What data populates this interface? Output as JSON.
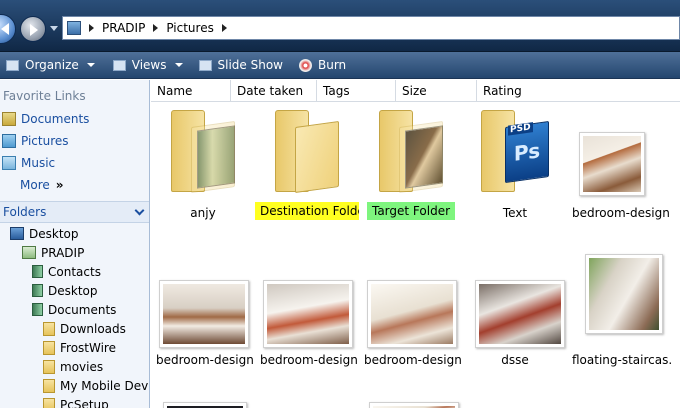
{
  "address": {
    "crumbs": [
      "PRADIP",
      "Pictures"
    ]
  },
  "toolbar": {
    "organize": "Organize",
    "views": "Views",
    "slideshow": "Slide Show",
    "burn": "Burn"
  },
  "left": {
    "favorites_heading": "Favorite Links",
    "favorites": [
      "Documents",
      "Pictures",
      "Music"
    ],
    "more": "More",
    "more_glyph": "»",
    "folders_heading": "Folders",
    "tree": [
      {
        "label": "Desktop"
      },
      {
        "label": "PRADIP"
      },
      {
        "label": "Contacts"
      },
      {
        "label": "Desktop"
      },
      {
        "label": "Documents"
      },
      {
        "label": "Downloads"
      },
      {
        "label": "FrostWire"
      },
      {
        "label": "movies"
      },
      {
        "label": "My Mobile Devi"
      },
      {
        "label": "PcSetup"
      }
    ]
  },
  "columns": [
    "Name",
    "Date taken",
    "Tags",
    "Size",
    "Rating"
  ],
  "items": [
    {
      "label": "anjy"
    },
    {
      "label": "Destination Folder"
    },
    {
      "label": "Target Folder"
    },
    {
      "label": "Text"
    },
    {
      "label": "bedroom-design..."
    },
    {
      "label": "bedroom-design..."
    },
    {
      "label": "bedroom-design..."
    },
    {
      "label": "bedroom-design..."
    },
    {
      "label": "dsse"
    },
    {
      "label": "floating-staircas..."
    }
  ],
  "ps_text": "Ps",
  "psd_text": "PSD"
}
